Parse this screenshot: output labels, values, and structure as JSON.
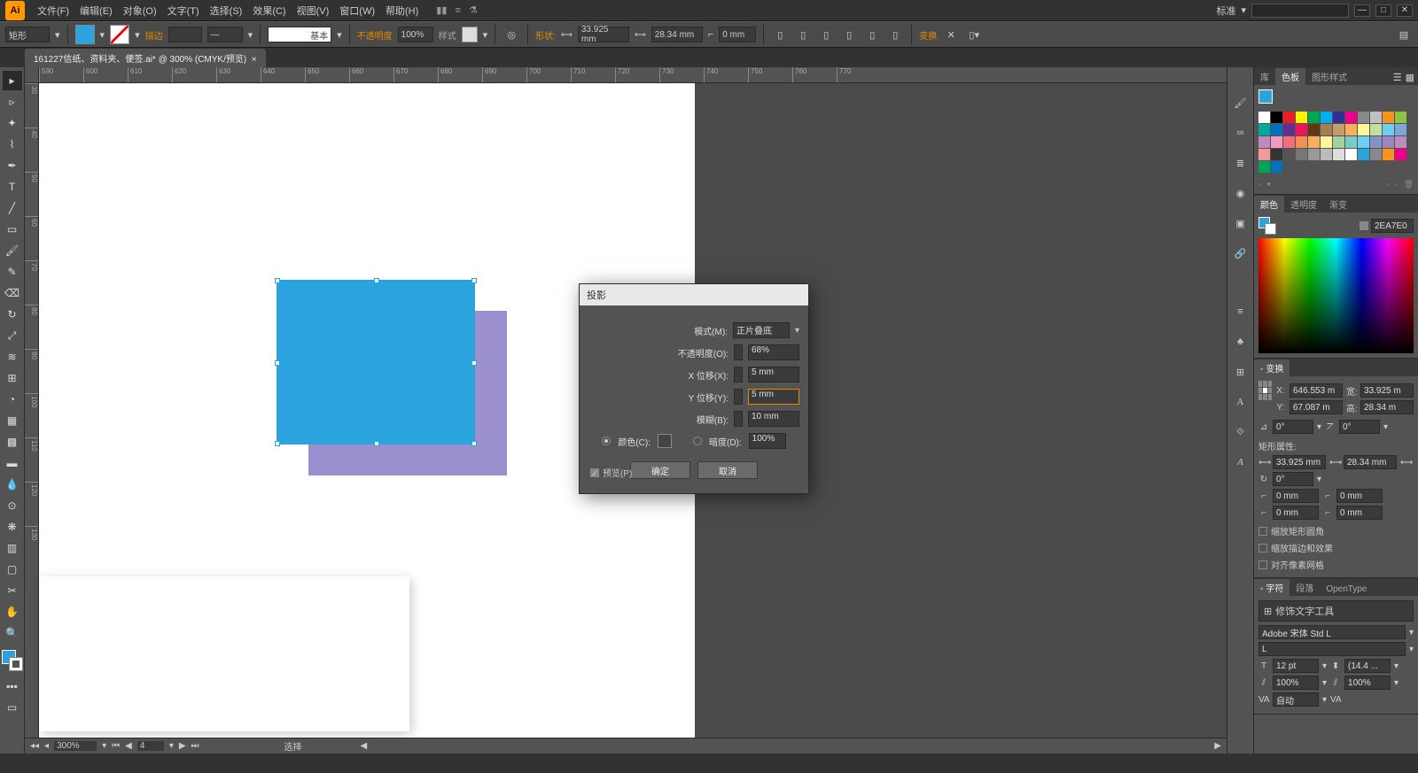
{
  "menu": {
    "items": [
      "文件(F)",
      "编辑(E)",
      "对象(O)",
      "文字(T)",
      "选择(S)",
      "效果(C)",
      "视图(V)",
      "窗口(W)",
      "帮助(H)"
    ],
    "workspace": "标准"
  },
  "controlbar": {
    "shape_label": "矩形",
    "stroke_label": "描边",
    "profile": "基本",
    "opacity_label": "不透明度",
    "opacity_value": "100%",
    "style_label": "样式",
    "shape_btn": "形状:",
    "w_value": "33.925 mm",
    "h_value": "28.34 mm",
    "corner_value": "0 mm",
    "transform_label": "变换"
  },
  "doctab": "161227信纸、资料夹、便签.ai* @ 300% (CMYK/预览)",
  "ruler_h": [
    "590",
    "600",
    "610",
    "620",
    "630",
    "640",
    "650",
    "660",
    "670",
    "680",
    "690",
    "700",
    "710",
    "720",
    "730",
    "740",
    "750",
    "760",
    "770"
  ],
  "ruler_v": [
    "30",
    "40",
    "50",
    "60",
    "70",
    "80",
    "90",
    "100",
    "110",
    "120",
    "130"
  ],
  "dialog": {
    "title": "投影",
    "mode_label": "模式(M):",
    "mode_value": "正片叠底",
    "opacity_label": "不透明度(O):",
    "opacity_value": "68%",
    "xoff_label": "X 位移(X):",
    "xoff_value": "5 mm",
    "yoff_label": "Y 位移(Y):",
    "yoff_value": "5 mm",
    "blur_label": "模糊(B):",
    "blur_value": "10 mm",
    "color_label": "颜色(C):",
    "dark_label": "暗度(D):",
    "dark_value": "100%",
    "preview_label": "预览(P)",
    "ok": "确定",
    "cancel": "取消"
  },
  "panels": {
    "swatches_tabs": [
      "库",
      "色板",
      "图形样式"
    ],
    "color_tabs": [
      "颜色",
      "透明度",
      "渐变"
    ],
    "color_hex": "2EA7E0",
    "transform_tab": "变换",
    "transform": {
      "x": "646.553 m",
      "y": "67.087 m",
      "w": "33.925 m",
      "h": "28.34 m",
      "angle": "0°",
      "shear": "0°"
    },
    "rectprops_title": "矩形属性:",
    "rectprops": {
      "w": "33.925 mm",
      "h": "28.34 mm",
      "angle": "0°",
      "r1": "0 mm",
      "r2": "0 mm",
      "r3": "0 mm",
      "r4": "0 mm"
    },
    "checks": [
      "缩放矩形圆角",
      "缩放描边和效果",
      "对齐像素网格"
    ],
    "char_tabs": [
      "字符",
      "段落",
      "OpenType"
    ],
    "touch_type": "修饰文字工具",
    "font": "Adobe 宋体 Std L",
    "font_style": "L",
    "size": "12 pt",
    "leading": "(14.4 ...",
    "tracking": "100%",
    "htracking": "100%"
  },
  "status": {
    "zoom": "300%",
    "page": "4",
    "label": "选择"
  },
  "swatch_colors": [
    "#ffffff",
    "#000000",
    "#ed1c24",
    "#fff200",
    "#00a651",
    "#00aeef",
    "#2e3192",
    "#ec008c",
    "#898989",
    "#c0c0c0",
    "#f7941d",
    "#8dc63e",
    "#00a99d",
    "#0072bc",
    "#662d91",
    "#ed145b",
    "#603913",
    "#a67c52",
    "#c69c6d",
    "#fbaf5d",
    "#fff799",
    "#c4df9b",
    "#6dcff6",
    "#7da7d9",
    "#bd8cbf",
    "#f49ac1",
    "#f26d7d",
    "#f68e56",
    "#fbaf5d",
    "#fff799",
    "#a3d39c",
    "#7accc8",
    "#6dcff6",
    "#8393ca",
    "#a186be",
    "#bd8cbf",
    "#f5989d",
    "#333333",
    "#555555",
    "#777777",
    "#999999",
    "#bbbbbb",
    "#dddddd",
    "#ffffff",
    "#2aa3df",
    "#898989",
    "#f7941d",
    "#ec008c",
    "#00a651",
    "#0072bc"
  ]
}
